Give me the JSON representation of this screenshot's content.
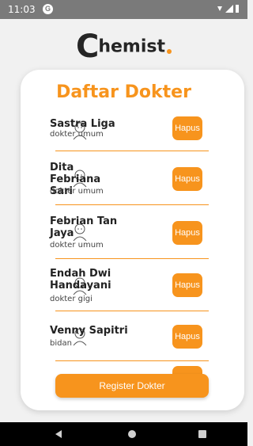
{
  "status_bar": {
    "time": "11:03",
    "app_icon": "G",
    "signal_icons": "signal-battery-icons"
  },
  "logo": {
    "first_letter": "C",
    "rest": "hemist"
  },
  "page_title": "Daftar Dokter",
  "doctors": [
    {
      "name": "Sastra Liga",
      "role": "dokter umum",
      "delete_label": "Hapus"
    },
    {
      "name": "Dita Febriana Sari",
      "role": "dokter umum",
      "delete_label": "Hapus"
    },
    {
      "name": "Febrian Tan Jaya",
      "role": "dokter umum",
      "delete_label": "Hapus"
    },
    {
      "name": "Endah Dwi Handayani",
      "role": "dokter gigi",
      "delete_label": "Hapus"
    },
    {
      "name": "Venny Sapitri",
      "role": "bidan",
      "delete_label": "Hapus"
    }
  ],
  "register_button": "Register Dokter",
  "colors": {
    "accent": "#f7941d",
    "background": "#f1f1f1",
    "card": "#ffffff",
    "text": "#222222"
  }
}
